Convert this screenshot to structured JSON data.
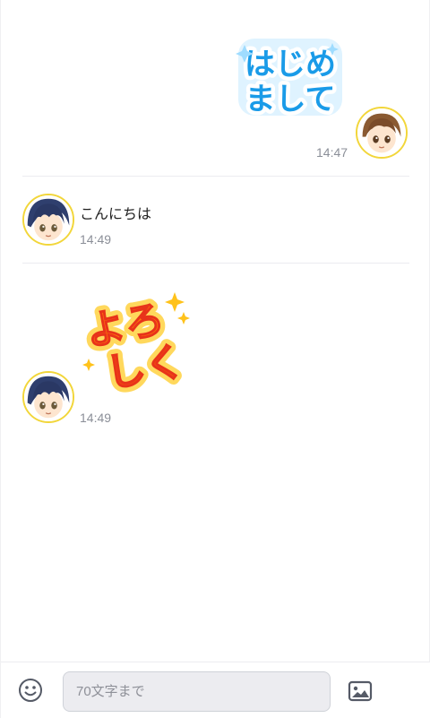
{
  "messages": [
    {
      "sender": "self",
      "type": "sticker",
      "sticker_text": [
        "はじめ",
        "まして"
      ],
      "time": "14:47"
    },
    {
      "sender": "other",
      "type": "text",
      "text": "こんにちは",
      "time": "14:49"
    },
    {
      "sender": "other",
      "type": "sticker",
      "sticker_text": [
        "よろ",
        "しく"
      ],
      "time": "14:49"
    }
  ],
  "composer": {
    "placeholder": "70文字まで",
    "value": ""
  },
  "icons": {
    "emoji": "smiley-face-icon",
    "image": "image-upload-icon"
  },
  "colors": {
    "avatar_border": "#f2d63a",
    "sticker_blue": "#1a9be8",
    "sticker_orange": "#ff8a00",
    "sticker_red": "#e8331a",
    "time_text": "#8b8f98",
    "input_bg": "#ececf0"
  }
}
